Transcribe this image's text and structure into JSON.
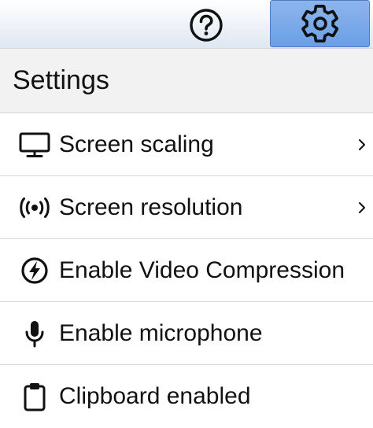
{
  "toolbar": {
    "help_icon": "help-circle-icon",
    "settings_icon": "gear-icon",
    "settings_active_color": "#7aa9ea"
  },
  "settings_panel": {
    "title": "Settings",
    "items": [
      {
        "label": "Screen scaling",
        "icon": "monitor-icon",
        "has_submenu": true
      },
      {
        "label": "Screen resolution",
        "icon": "broadcast-icon",
        "has_submenu": true
      },
      {
        "label": "Enable Video Compression",
        "icon": "lightning-bolt-icon",
        "has_submenu": false
      },
      {
        "label": "Enable microphone",
        "icon": "microphone-icon",
        "has_submenu": false
      },
      {
        "label": "Clipboard enabled",
        "icon": "clipboard-icon",
        "has_submenu": false
      }
    ]
  }
}
